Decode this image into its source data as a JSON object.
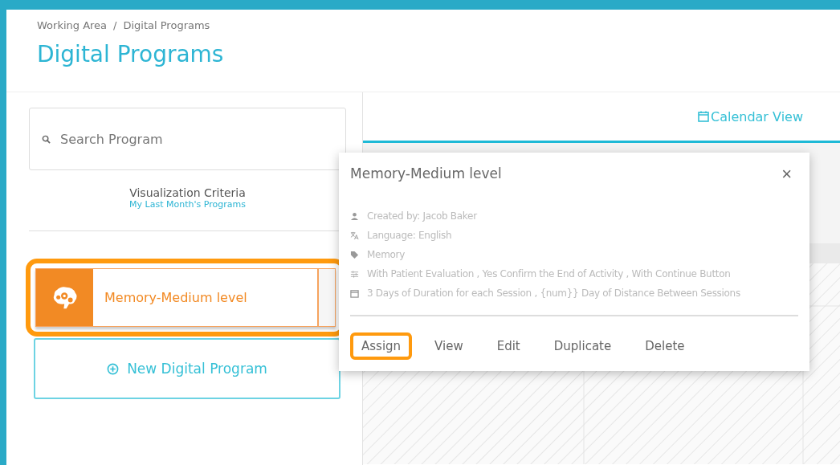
{
  "breadcrumb": [
    {
      "label": "Working Area"
    },
    {
      "label": "Digital Programs"
    }
  ],
  "breadcrumb_separator": "/",
  "title": "Digital Programs",
  "search": {
    "placeholder": "Search Program"
  },
  "criteria": {
    "label": "Visualization Criteria",
    "value": "My Last Month's Programs"
  },
  "programs": [
    {
      "name": "Memory-Medium level",
      "highlighted": true
    }
  ],
  "new_button": "New Digital Program",
  "tabs": [
    {
      "label": "Calendar View",
      "selected": true
    }
  ],
  "popover": {
    "title": "Memory-Medium level",
    "close": "×",
    "details": [
      {
        "kind": "person",
        "text": "Created by: Jacob Baker"
      },
      {
        "kind": "language",
        "text": "Language: English"
      },
      {
        "kind": "tag",
        "text": "Memory"
      },
      {
        "kind": "settings",
        "text": "With Patient Evaluation , Yes Confirm the End of Activity , With Continue Button"
      },
      {
        "kind": "calendar",
        "text": "3 Days of Duration for each Session , {num}} Day of Distance Between Sessions"
      }
    ],
    "actions": [
      {
        "label": "Assign",
        "highlighted": true
      },
      {
        "label": "View",
        "highlighted": false
      },
      {
        "label": "Edit",
        "highlighted": false
      },
      {
        "label": "Duplicate",
        "highlighted": false
      },
      {
        "label": "Delete",
        "highlighted": false
      }
    ]
  }
}
